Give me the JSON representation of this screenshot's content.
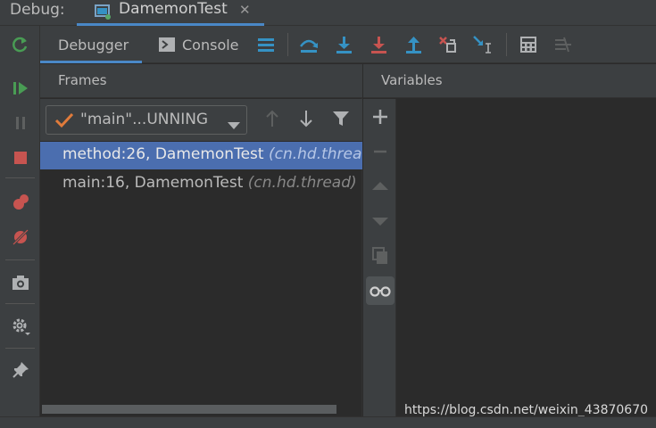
{
  "header": {
    "debug_label": "Debug:",
    "run_tab_title": "DamemonTest",
    "close_glyph": "✕"
  },
  "colors": {
    "accent": "#4a88c7",
    "selection": "#4b6eaf",
    "green": "#499c54",
    "red": "#c75450",
    "blue": "#3592c4"
  },
  "left_toolbar": [
    "rerun-icon",
    "resume-icon",
    "pause-icon",
    "stop-icon",
    "view-breakpoints-icon",
    "mute-breakpoints-icon",
    "camera-icon",
    "settings-icon",
    "pin-icon"
  ],
  "toolbar": {
    "tabs": [
      {
        "label": "Debugger",
        "active": true
      },
      {
        "label": "Console",
        "active": false
      }
    ],
    "actions": [
      "show-execution-point-icon",
      "step-over-icon",
      "step-into-icon",
      "force-step-into-icon",
      "step-out-icon",
      "drop-frame-icon",
      "run-to-cursor-icon",
      "evaluate-expression-icon",
      "trace-icon"
    ]
  },
  "frames": {
    "title": "Frames",
    "thread_selected": "\"main\"...UNNING",
    "rows": [
      {
        "method": "method:26, DamemonTest",
        "pkg": "(cn.hd.thread)",
        "selected": true
      },
      {
        "method": "main:16, DamemonTest",
        "pkg": "(cn.hd.thread)",
        "selected": false
      }
    ]
  },
  "variables": {
    "title": "Variables"
  },
  "watermark": "https://blog.csdn.net/weixin_43870670"
}
